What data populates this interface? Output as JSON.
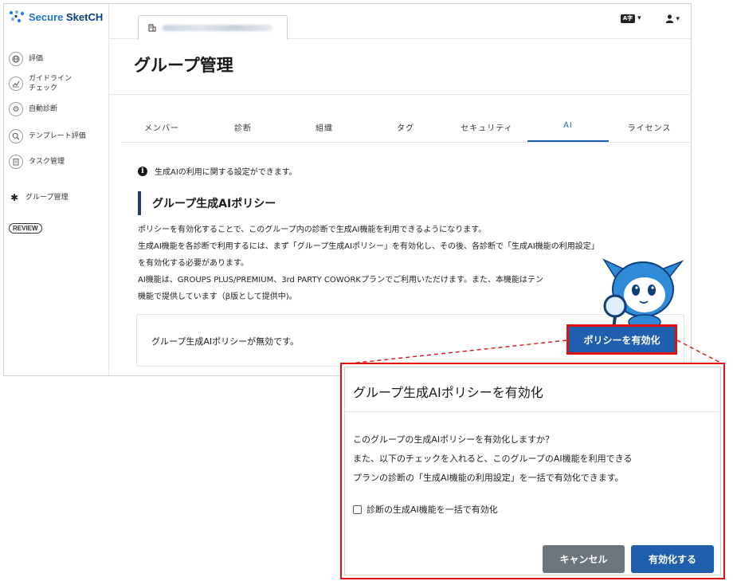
{
  "app": {
    "logo_text_a": "Secure ",
    "logo_text_b": "SketCH",
    "brand_color": "#1e73d2"
  },
  "sidebar": {
    "items": [
      {
        "label": "評価",
        "icon": "globe-icon"
      },
      {
        "label_line1": "ガイドライン",
        "label_line2": "チェック",
        "icon": "chart-icon"
      },
      {
        "label": "自動診断",
        "icon": "gear-icon"
      },
      {
        "label": "テンプレート評価",
        "icon": "search-icon"
      },
      {
        "label": "タスク管理",
        "icon": "clipboard-icon"
      },
      {
        "label": "グループ管理",
        "icon": "cog-icon"
      }
    ],
    "badge": "REVIEW"
  },
  "header": {
    "file_tab_icon": "building-icon",
    "language_icon_text": "A字",
    "user_icon": "user-icon"
  },
  "main": {
    "page_title": "グループ管理",
    "tabs": [
      {
        "label": "メンバー"
      },
      {
        "label": "診断"
      },
      {
        "label": "組織"
      },
      {
        "label": "タグ"
      },
      {
        "label": "セキュリティ"
      },
      {
        "label": "AI",
        "active": true
      },
      {
        "label": "ライセンス"
      }
    ],
    "info_text": "生成AIの利用に関する設定ができます。",
    "section_title": "グループ生成AIポリシー",
    "desc_lines": [
      "ポリシーを有効化することで、このグループ内の診断で生成AI機能を利用できるようになります。",
      "生成AI機能を各診断で利用するには、まず「グループ生成AIポリシー」を有効化し、その後、各診断で「生成AI機能の利用設定」",
      "を有効化する必要があります。",
      "AI機能は、GROUPS PLUS/PREMIUM、3rd PARTY COWORKプランでご利用いただけます。また、本機能はテン",
      "機能で提供しています（β版として提供中)。"
    ],
    "status_text": "グループ生成AIポリシーが無効です。",
    "enable_button": "ポリシーを有効化"
  },
  "modal": {
    "title": "グループ生成AIポリシーを有効化",
    "lines": [
      "このグループの生成AIポリシーを有効化しますか？",
      "また、以下のチェックを入れると、このグループのAI機能を利用できる",
      "プランの診断の「生成AI機能の利用設定」を一括で有効化できます。"
    ],
    "checkbox_label": "診断の生成AI機能を一括で有効化",
    "checkbox_checked": false,
    "cancel_label": "キャンセル",
    "confirm_label": "有効化する",
    "primary_color": "#1f5fae",
    "highlight_color": "#e01010"
  }
}
